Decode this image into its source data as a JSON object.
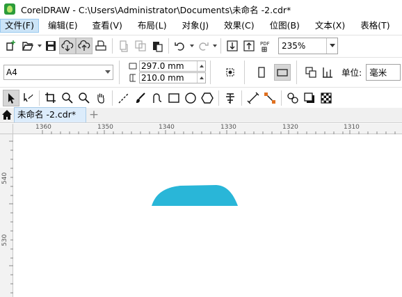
{
  "window": {
    "title": "CorelDRAW - C:\\Users\\Administrator\\Documents\\未命名 -2.cdr*"
  },
  "menu": [
    {
      "label": "文件(F)",
      "name": "menu-file",
      "active": true
    },
    {
      "label": "编辑(E)",
      "name": "menu-edit"
    },
    {
      "label": "查看(V)",
      "name": "menu-view"
    },
    {
      "label": "布局(L)",
      "name": "menu-layout"
    },
    {
      "label": "对象(J)",
      "name": "menu-object"
    },
    {
      "label": "效果(C)",
      "name": "menu-effects"
    },
    {
      "label": "位图(B)",
      "name": "menu-bitmaps"
    },
    {
      "label": "文本(X)",
      "name": "menu-text"
    },
    {
      "label": "表格(T)",
      "name": "menu-table"
    }
  ],
  "standard_toolbar": {
    "zoom_value": "235%"
  },
  "property_bar": {
    "page_size": "A4",
    "width": "297.0 mm",
    "height": "210.0 mm",
    "units_label": "单位:",
    "units_value": "毫米"
  },
  "document_tab": {
    "label": "未命名 -2.cdr*"
  },
  "ruler": {
    "top_labels": [
      "1360",
      "1350",
      "1340",
      "1330",
      "1320",
      "1310"
    ],
    "left_labels": [
      "540",
      "530"
    ]
  },
  "canvas": {
    "shape_color": "#29b6d8"
  },
  "colors": {
    "menu_active_bg": "#cce4f7",
    "tab_active_bg": "#dcecfb"
  }
}
